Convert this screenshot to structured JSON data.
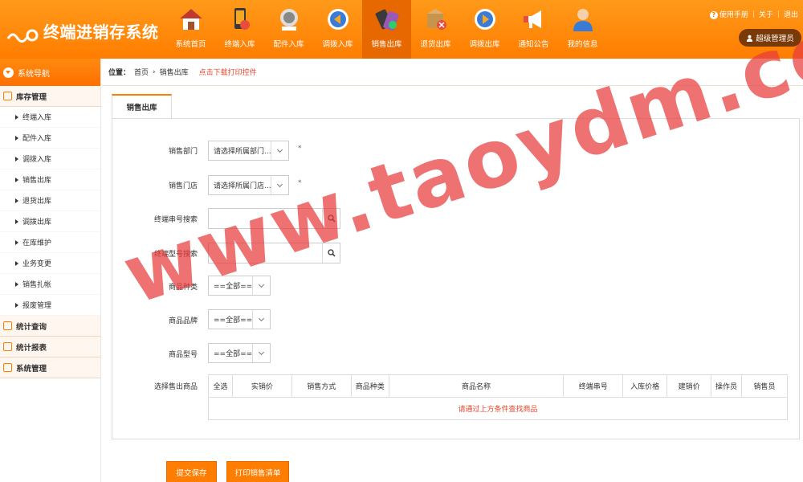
{
  "app": {
    "title": "终端进销存系统"
  },
  "nav": [
    {
      "label": "系统首页",
      "icon": "house-icon"
    },
    {
      "label": "终端入库",
      "icon": "phone-in-icon"
    },
    {
      "label": "配件入库",
      "icon": "accessory-icon"
    },
    {
      "label": "调拨入库",
      "icon": "transfer-in-icon"
    },
    {
      "label": "销售出库",
      "icon": "sales-out-icon",
      "active": true
    },
    {
      "label": "退货出库",
      "icon": "return-box-icon"
    },
    {
      "label": "调拨出库",
      "icon": "transfer-out-icon"
    },
    {
      "label": "通知公告",
      "icon": "megaphone-icon"
    },
    {
      "label": "我的信息",
      "icon": "user-icon"
    }
  ],
  "top_links": {
    "help": "使用手册",
    "about": "关于",
    "logout": "退出"
  },
  "user": {
    "role": "超级管理员"
  },
  "sidebar": {
    "title": "系统导航",
    "groups": [
      {
        "label": "库存管理",
        "items": [
          "终端入库",
          "配件入库",
          "调拨入库",
          "销售出库",
          "退货出库",
          "调拨出库",
          "在库维护",
          "业务变更",
          "销售扎帐",
          "报废管理"
        ]
      },
      {
        "label": "统计查询",
        "items": []
      },
      {
        "label": "统计报表",
        "items": []
      },
      {
        "label": "系统管理",
        "items": []
      }
    ]
  },
  "breadcrumb": {
    "prefix": "位置：",
    "home": "首页",
    "current": "销售出库",
    "download": "点击下载打印控件"
  },
  "tab": {
    "label": "销售出库"
  },
  "form": {
    "dept": {
      "label": "销售部门",
      "value": "请选择所属部门...",
      "required": "*"
    },
    "store": {
      "label": "销售门店",
      "value": "请选择所属门店...",
      "required": "*"
    },
    "serial": {
      "label": "终端串号搜索",
      "value": ""
    },
    "model": {
      "label": "终端型号搜索",
      "value": ""
    },
    "category": {
      "label": "商品种类",
      "value": "==全部=="
    },
    "brand": {
      "label": "商品品牌",
      "value": "==全部=="
    },
    "type": {
      "label": "商品型号",
      "value": "==全部=="
    },
    "goods_label": "选择售出商品"
  },
  "table": {
    "headers": [
      "全选",
      "实销价",
      "销售方式",
      "商品种类",
      "商品名称",
      "终端串号",
      "入库价格",
      "建销价",
      "操作员",
      "销售员"
    ],
    "empty": "请通过上方条件查找商品"
  },
  "buttons": {
    "submit": "提交保存",
    "print": "打印销售清单"
  },
  "watermark": "www.taoydm.com",
  "colors": {
    "accent": "#ff7d00",
    "active": "#e86800",
    "alert": "#e8452b"
  }
}
